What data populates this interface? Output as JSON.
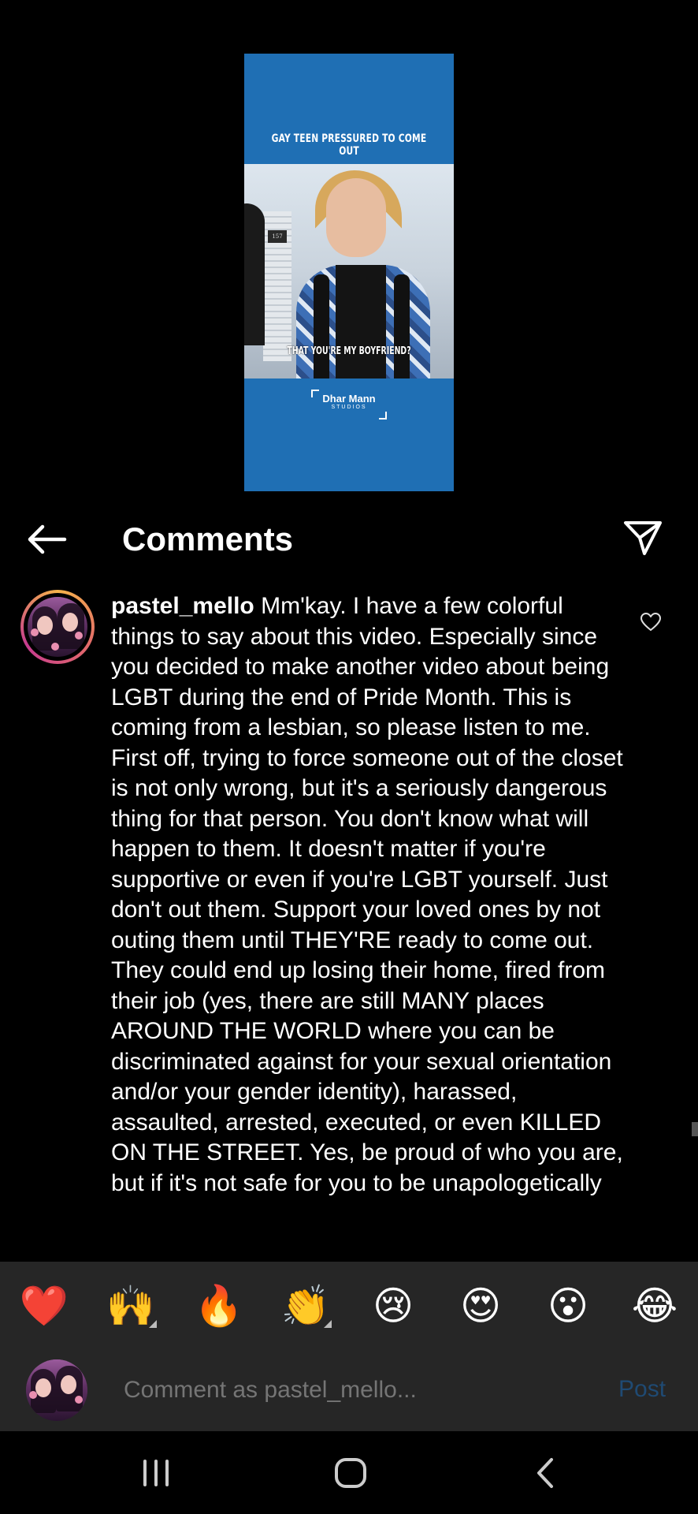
{
  "video": {
    "caption_top": "GAY TEEN PRESSURED TO COME OUT",
    "caption_bottom": "THAT YOU'RE MY BOYFRIEND?",
    "room_number": "157",
    "logo_main": "Dhar Mann",
    "logo_sub": "STUDIOS"
  },
  "header": {
    "title": "Comments",
    "back_icon": "arrow-left-icon",
    "share_icon": "paper-plane-icon"
  },
  "comment": {
    "username": "pastel_mello",
    "text": "Mm'kay. I have a few colorful things to say about this video. Especially since you decided to make another video about being LGBT during the end of Pride Month. This is coming from a lesbian, so please listen to me. First off, trying to force someone out of the closet is not only wrong, but it's a seriously dangerous thing for that person. You don't know what will happen to them. It doesn't matter if you're supportive or even if you're LGBT yourself. Just don't out them. Support your loved ones by not outing them until THEY'RE ready to come out. They could end up losing their home, fired from their job (yes, there are still MANY places AROUND THE WORLD where you can be discriminated against for your sexual orientation and/or your gender identity), harassed, assaulted, arrested, executed, or even KILLED ON THE STREET. Yes, be proud of who you are, but if it's not safe for you to be unapologetically",
    "like_icon": "heart-outline-icon"
  },
  "reactions": [
    "❤️",
    "🙌",
    "🔥",
    "👏",
    "😢",
    "😍",
    "😮",
    "😂"
  ],
  "composer": {
    "placeholder": "Comment as pastel_mello...",
    "post_label": "Post"
  },
  "navbar": {
    "recents_icon": "recent-apps-icon",
    "home_icon": "home-icon",
    "back_icon": "back-chevron-icon"
  },
  "colors": {
    "background": "#000000",
    "panel": "#262626",
    "video_blue": "#1f6fb4",
    "post_disabled": "#1f4a73",
    "placeholder": "#a8a8a8"
  }
}
